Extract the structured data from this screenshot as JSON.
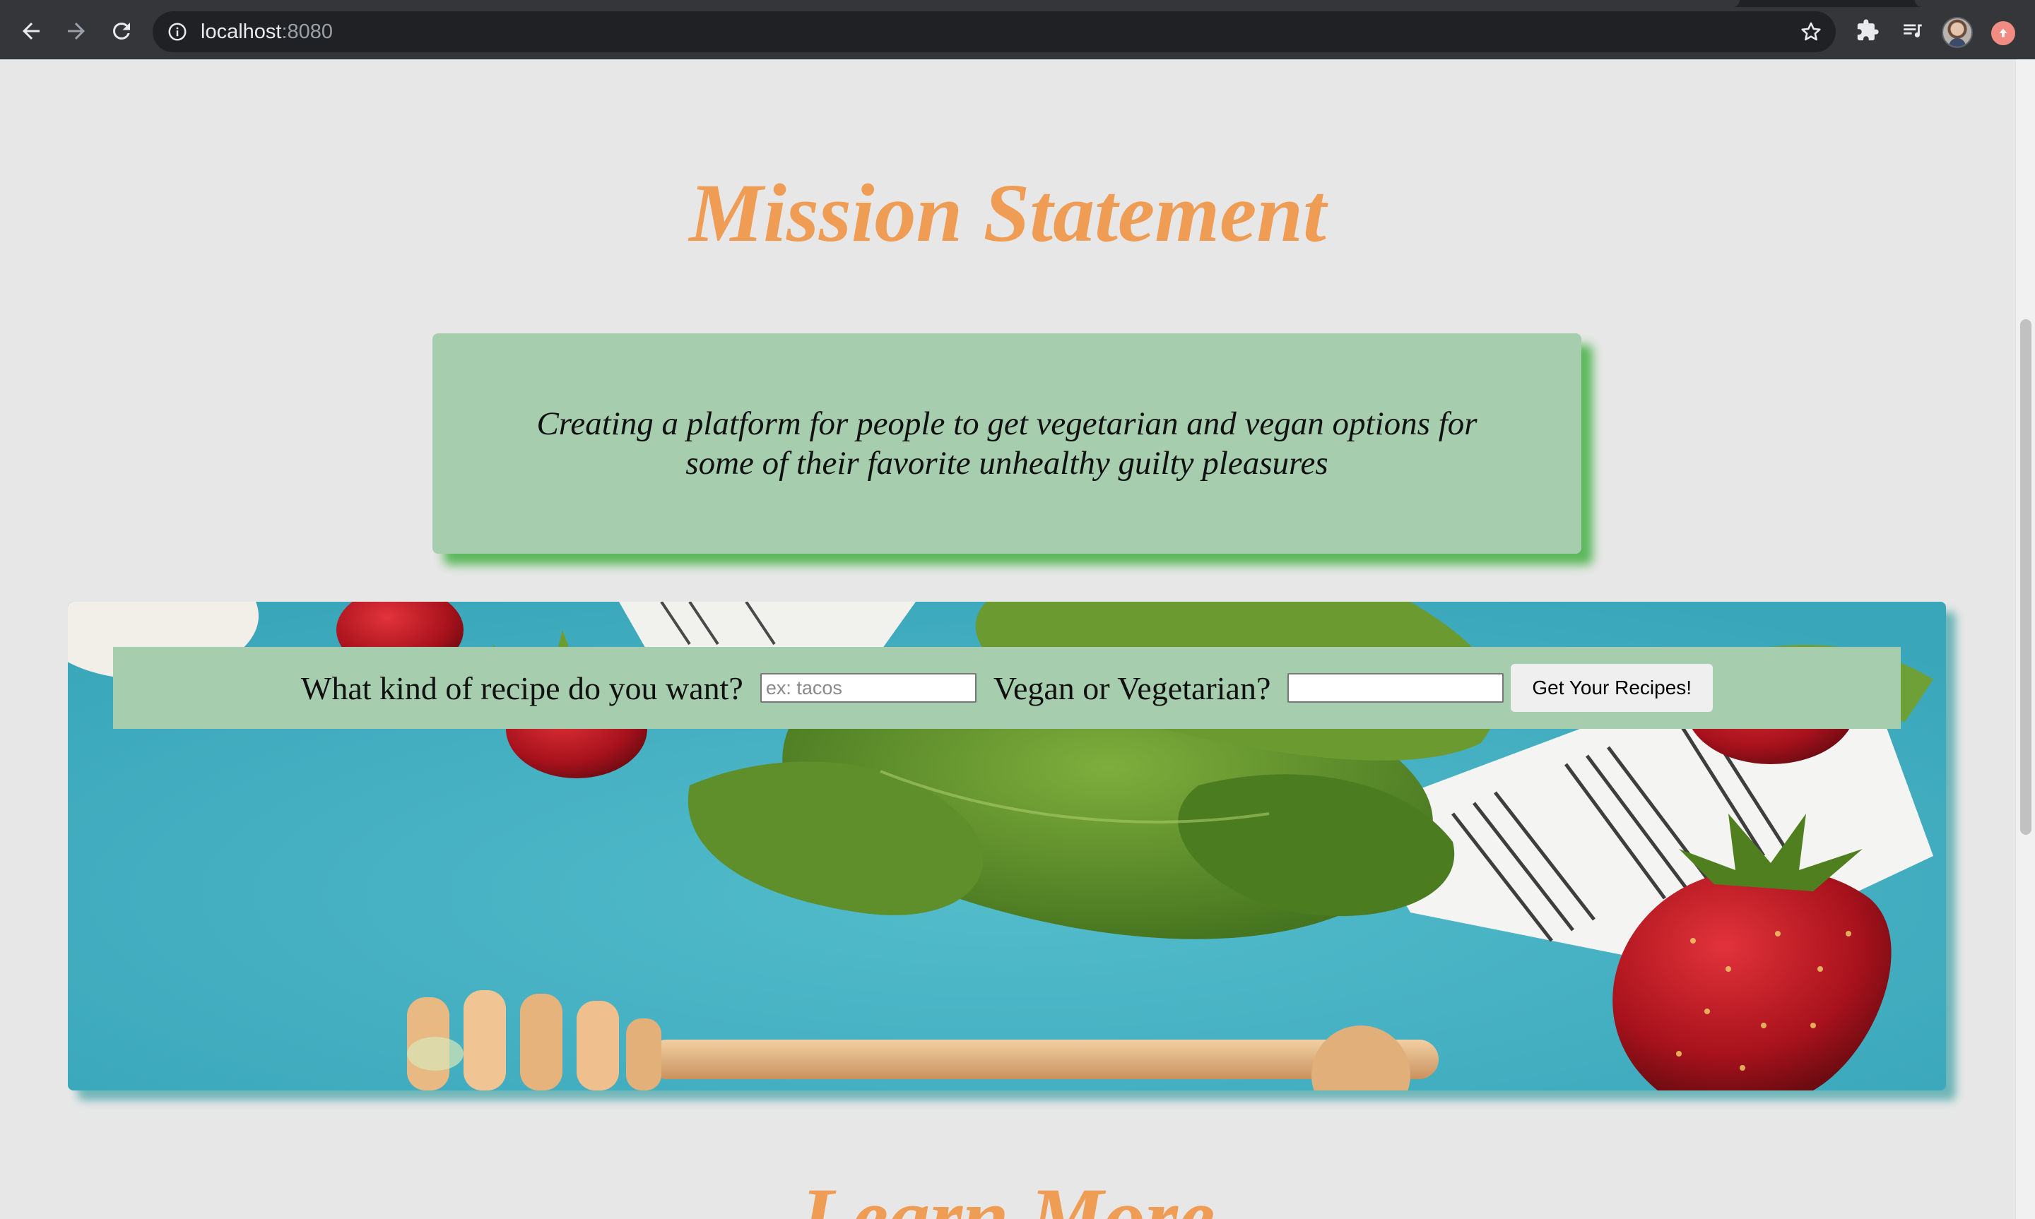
{
  "browser": {
    "url_host": "localhost",
    "url_port": ":8080"
  },
  "page": {
    "mission_title": "Mission Statement",
    "mission_text": "Creating a platform for people to get vegetarian and vegan options for some of their favorite unhealthy guilty pleasures",
    "search": {
      "recipe_label": "What kind of recipe do you want?",
      "recipe_placeholder": "ex: tacos",
      "recipe_value": "",
      "diet_label": "Vegan or Vegetarian?",
      "diet_value": "",
      "submit_label": "Get Your Recipes!"
    },
    "learn_more_title": "Learn More"
  },
  "colors": {
    "heading": "#ef9c55",
    "panel_green": "#a7cdaf",
    "panel_shadow": "#5cb85c",
    "page_bg": "#e7e7e7"
  },
  "icons": {
    "back": "back-arrow-icon",
    "forward": "forward-arrow-icon",
    "reload": "reload-icon",
    "site_info": "info-icon",
    "bookmark": "star-icon",
    "extensions": "puzzle-icon",
    "media": "media-queue-icon",
    "profile": "avatar",
    "update": "update-icon"
  }
}
